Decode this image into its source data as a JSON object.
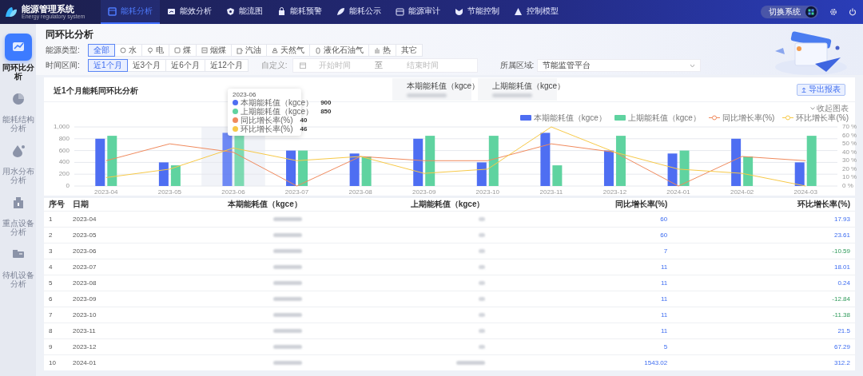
{
  "header": {
    "logo_title": "能源管理系统",
    "logo_subtitle": "Energy regulatory system",
    "switch_button": "切换系统",
    "nav": [
      {
        "label": "能耗分析",
        "selected": true
      },
      {
        "label": "能效分析",
        "selected": false
      },
      {
        "label": "能流图",
        "selected": false
      },
      {
        "label": "能耗预警",
        "selected": false
      },
      {
        "label": "能耗公示",
        "selected": false
      },
      {
        "label": "能源审计",
        "selected": false
      },
      {
        "label": "节能控制",
        "selected": false
      },
      {
        "label": "控制模型",
        "selected": false
      }
    ]
  },
  "sidebar": {
    "items": [
      {
        "label": "同环比分析",
        "selected": true
      },
      {
        "label": "能耗结构分析",
        "selected": false
      },
      {
        "label": "用水分布分析",
        "selected": false
      },
      {
        "label": "重点设备分析",
        "selected": false
      },
      {
        "label": "待机设备分析",
        "selected": false
      }
    ]
  },
  "page_title": "同环比分析",
  "filters": {
    "energy_type": {
      "label": "能源类型:",
      "options": [
        {
          "label": "全部",
          "selected": true
        },
        {
          "label": "水",
          "selected": false
        },
        {
          "label": "电",
          "selected": false
        },
        {
          "label": "煤",
          "selected": false
        },
        {
          "label": "烟煤",
          "selected": false
        },
        {
          "label": "汽油",
          "selected": false
        },
        {
          "label": "天然气",
          "selected": false
        },
        {
          "label": "液化石油气",
          "selected": false
        },
        {
          "label": "热",
          "selected": false
        },
        {
          "label": "其它",
          "selected": false
        }
      ]
    },
    "time_range": {
      "label": "时间区间:",
      "options": [
        {
          "label": "近1个月",
          "selected": true
        },
        {
          "label": "近3个月",
          "selected": false
        },
        {
          "label": "近6个月",
          "selected": false
        },
        {
          "label": "近12个月",
          "selected": false
        }
      ]
    },
    "custom": {
      "label": "自定义:",
      "start_placeholder": "开始时间",
      "separator": "至",
      "end_placeholder": "结束时间"
    },
    "region": {
      "label": "所属区域:",
      "value": "节能监管平台"
    }
  },
  "chart_card": {
    "title": "近1个月能耗同环比分析",
    "stats": [
      {
        "label": "本期能耗值（kgce）"
      },
      {
        "label": "上期能耗值（kgce）"
      }
    ],
    "export_button": "导出报表",
    "collapse_toggle": "收起图表",
    "chart_data": {
      "type": "bar",
      "grid": true,
      "bands": [
        {
          "axis": "x",
          "from": "2023-06",
          "to": "2023-06",
          "color": "#f1f3f8"
        }
      ],
      "categories": [
        "2023-04",
        "2023-05",
        "2023-06",
        "2023-07",
        "2023-08",
        "2023-09",
        "2023-10",
        "2023-11",
        "2023-12",
        "2024-01",
        "2024-02",
        "2024-03"
      ],
      "ylim": [
        0,
        1000
      ],
      "yticks": [
        0,
        200,
        400,
        600,
        800,
        {
          "value": 1000,
          "label": "1,000"
        }
      ],
      "y2lim": [
        0,
        70
      ],
      "y2ticks": [
        {
          "value": 0,
          "label": "0 %"
        },
        {
          "value": 10,
          "label": "10 %"
        },
        {
          "value": 20,
          "label": "20 %"
        },
        {
          "value": 30,
          "label": "30 %"
        },
        {
          "value": 40,
          "label": "40 %"
        },
        {
          "value": 50,
          "label": "50 %"
        },
        {
          "value": 60,
          "label": "60 %"
        },
        {
          "value": 70,
          "label": "70 %"
        }
      ],
      "series": [
        {
          "name": "本期能耗值（kgce）",
          "color": "#4e6ef2",
          "type": "bar",
          "values": [
            800,
            400,
            900,
            600,
            550,
            800,
            400,
            900,
            600,
            550,
            800,
            400
          ]
        },
        {
          "name": "上期能耗值（kgce）",
          "color": "#5fd3a0",
          "type": "bar",
          "values": [
            850,
            350,
            850,
            600,
            500,
            850,
            850,
            350,
            850,
            600,
            500,
            850
          ]
        },
        {
          "name": "同比增长率(%)",
          "color": "#f08a5d",
          "type": "line",
          "axis": "y2",
          "values": [
            30,
            50,
            40,
            0,
            35,
            30,
            30,
            50,
            40,
            0,
            35,
            30
          ]
        },
        {
          "name": "环比增长率(%)",
          "color": "#f7c948",
          "type": "line",
          "axis": "y2",
          "values": [
            10,
            20,
            45,
            30,
            35,
            15,
            20,
            70,
            40,
            20,
            15,
            0
          ]
        }
      ]
    },
    "tooltip": {
      "title": "2023-06",
      "items": [
        {
          "name": "本期能耗值（kgce）",
          "value": "900",
          "color": "#4e6ef2"
        },
        {
          "name": "上期能耗值（kgce）",
          "value": "850",
          "color": "#5fd3a0"
        },
        {
          "name": "同比增长率(%)",
          "value": "40",
          "color": "#f08a5d"
        },
        {
          "name": "环比增长率(%)",
          "value": "46",
          "color": "#f7c948"
        }
      ]
    }
  },
  "table": {
    "columns": [
      "序号",
      "日期",
      "本期能耗值（kgce）",
      "上期能耗值（kgce）",
      "同比增长率(%)",
      "环比增长率(%)"
    ],
    "rows": [
      {
        "index": "1",
        "date": "2023-04",
        "yoy": "60",
        "mom": "17.93",
        "mom_negative": false
      },
      {
        "index": "2",
        "date": "2023-05",
        "yoy": "60",
        "mom": "23.61",
        "mom_negative": false
      },
      {
        "index": "3",
        "date": "2023-06",
        "yoy": "7",
        "mom": "-10.59",
        "mom_negative": true
      },
      {
        "index": "4",
        "date": "2023-07",
        "yoy": "11",
        "mom": "18.01",
        "mom_negative": false
      },
      {
        "index": "5",
        "date": "2023-08",
        "yoy": "11",
        "mom": "0.24",
        "mom_negative": false
      },
      {
        "index": "6",
        "date": "2023-09",
        "yoy": "11",
        "mom": "-12.84",
        "mom_negative": true
      },
      {
        "index": "7",
        "date": "2023-10",
        "yoy": "11",
        "mom": "-11.38",
        "mom_negative": true
      },
      {
        "index": "8",
        "date": "2023-11",
        "yoy": "11",
        "mom": "21.5",
        "mom_negative": false
      },
      {
        "index": "9",
        "date": "2023-12",
        "yoy": "5",
        "mom": "67.29",
        "mom_negative": false
      },
      {
        "index": "10",
        "date": "2024-01",
        "yoy": "1543.02",
        "mom": "312.2",
        "mom_negative": false
      }
    ]
  }
}
